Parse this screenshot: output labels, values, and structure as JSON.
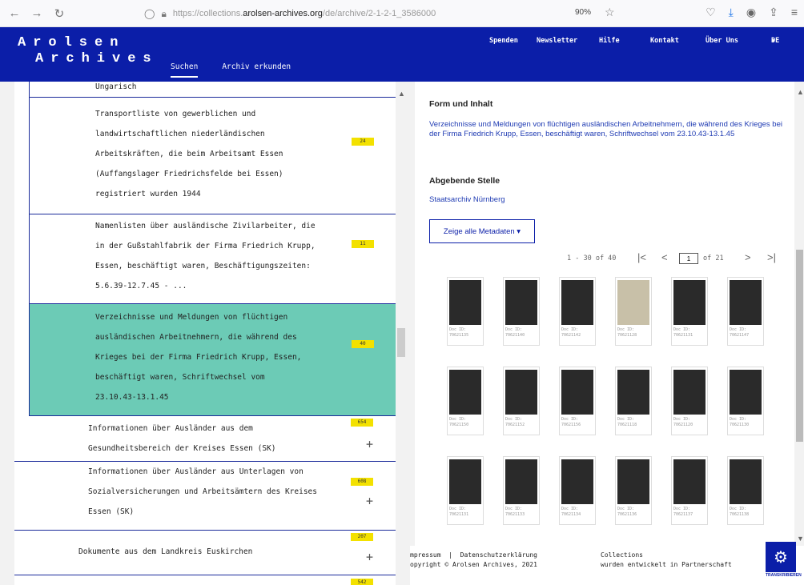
{
  "browser": {
    "url_prefix": "https://collections.",
    "url_host": "arolsen-archives.org",
    "url_path": "/de/archive/2-1-2-1_3586000",
    "zoom": "90%"
  },
  "header": {
    "logo_line1": "Arolsen",
    "logo_line2": "Archives",
    "main_nav": [
      "Suchen",
      "Archiv erkunden"
    ],
    "top_nav": [
      "Spenden",
      "Newsletter",
      "Hilfe",
      "Kontakt",
      "Über Uns",
      "DE"
    ]
  },
  "tree": {
    "items": [
      {
        "lines": [
          "Ungarisch"
        ],
        "badge": ""
      },
      {
        "lines": [
          "Transportliste von gewerblichen und",
          "landwirtschaftlichen niederländischen",
          "Arbeitskräften, die beim Arbeitsamt Essen",
          "(Auffangslager Friedrichsfelde bei Essen)",
          "registriert wurden 1944"
        ],
        "badge": "24"
      },
      {
        "lines": [
          "Namenlisten über ausländische Zivilarbeiter, die",
          "in der Gußstahlfabrik der Firma Friedrich Krupp,",
          "Essen, beschäftigt waren, Beschäftigungszeiten:",
          "5.6.39-12.7.45 - ..."
        ],
        "badge": "11"
      },
      {
        "lines": [
          "Verzeichnisse und Meldungen von flüchtigen",
          "ausländischen Arbeitnehmern, die während des",
          "Krieges bei der Firma Friedrich Krupp, Essen,",
          "beschäftigt waren, Schriftwechsel vom",
          "23.10.43-13.1.45"
        ],
        "badge": "40"
      },
      {
        "lines": [
          "Informationen über Ausländer aus dem",
          "Gesundheitsbereich der Kreises Essen (SK)"
        ],
        "badge": "654"
      },
      {
        "lines": [
          "Informationen über Ausländer aus Unterlagen von",
          "Sozialversicherungen und Arbeitsämtern des Kreises",
          "Essen (SK)"
        ],
        "badge": "608"
      },
      {
        "lines": [
          "Dokumente aus dem Landkreis Euskirchen"
        ],
        "badge": "207"
      },
      {
        "lines": [],
        "badge": "542"
      }
    ]
  },
  "detail": {
    "form_heading": "Form und Inhalt",
    "form_text": "Verzeichnisse und Meldungen von flüchtigen ausländischen Arbeitnehmern, die während des Krieges bei der Firma Friedrich Krupp, Essen, beschäftigt waren, Schriftwechsel vom 23.10.43-13.1.45",
    "source_heading": "Abgebende Stelle",
    "source_text": "Staatsarchiv Nürnberg",
    "meta_button": "Zeige alle Metadaten ▾",
    "pager_range": "1 - 30 of 40",
    "pager_page": "1",
    "pager_total": "of 21",
    "thumbs": [
      {
        "doc": "Doc ID:",
        "id": "70621135",
        "light": false
      },
      {
        "doc": "Doc ID:",
        "id": "70621140",
        "light": false
      },
      {
        "doc": "Doc ID:",
        "id": "70621142",
        "light": false
      },
      {
        "doc": "Doc ID:",
        "id": "70621128",
        "light": true
      },
      {
        "doc": "Doc ID:",
        "id": "70621131",
        "light": false
      },
      {
        "doc": "Doc ID:",
        "id": "70621147",
        "light": false
      },
      {
        "doc": "Doc ID:",
        "id": "70621150",
        "light": false
      },
      {
        "doc": "Doc ID:",
        "id": "70621152",
        "light": false
      },
      {
        "doc": "Doc ID:",
        "id": "70621156",
        "light": false
      },
      {
        "doc": "Doc ID:",
        "id": "70621118",
        "light": false
      },
      {
        "doc": "Doc ID:",
        "id": "70621120",
        "light": false
      },
      {
        "doc": "Doc ID:",
        "id": "70621130",
        "light": false
      },
      {
        "doc": "Doc ID:",
        "id": "70621131",
        "light": false
      },
      {
        "doc": "Doc ID:",
        "id": "70621133",
        "light": false
      },
      {
        "doc": "Doc ID:",
        "id": "70621134",
        "light": false
      },
      {
        "doc": "Doc ID:",
        "id": "70621136",
        "light": false
      },
      {
        "doc": "Doc ID:",
        "id": "70621137",
        "light": false
      },
      {
        "doc": "Doc ID:",
        "id": "70621138",
        "light": false
      }
    ]
  },
  "footer": {
    "impressum": "mpressum",
    "sep": "|",
    "privacy": "Datenschutzerklärung",
    "copyright": "opyright © Arolsen Archives, 2021",
    "collections": "Collections",
    "partner": "wurden entwickelt in Partnerschaft"
  },
  "fab_label": "TRANSKRIBIEREN"
}
